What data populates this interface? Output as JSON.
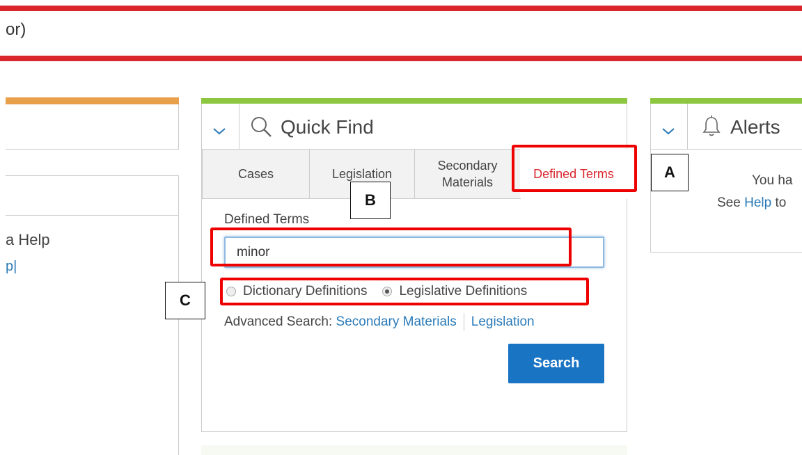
{
  "banner": {
    "text": "or)"
  },
  "left_panel": {
    "help_text": "a Help",
    "link_fragment": "p|"
  },
  "quick_find": {
    "title": "Quick Find",
    "tabs": [
      {
        "label": "Cases"
      },
      {
        "label": "Legislation"
      },
      {
        "label": "Secondary\nMaterials"
      },
      {
        "label": "Defined Terms"
      }
    ],
    "active_tab": "Defined Terms",
    "field_label": "Defined Terms",
    "input_value": "minor",
    "radio_options": [
      {
        "label": "Dictionary Definitions",
        "checked": false
      },
      {
        "label": "Legislative Definitions",
        "checked": true
      }
    ],
    "advanced_search_label": "Advanced Search:",
    "advanced_links": [
      "Secondary Materials",
      "Legislation"
    ],
    "search_button": "Search"
  },
  "alerts": {
    "title": "Alerts",
    "text1": "You ha",
    "text2_prefix": "See ",
    "text2_link": "Help",
    "text2_suffix": " to"
  },
  "annotations": {
    "a": "A",
    "b": "B",
    "c": "C"
  },
  "colors": {
    "brand_red": "#d9262c",
    "green_bar": "#8dc63f",
    "orange_bar": "#e8a04a",
    "link_blue": "#2a7ab8",
    "button_blue": "#1a74c4",
    "annotation_red": "#ee0000"
  }
}
